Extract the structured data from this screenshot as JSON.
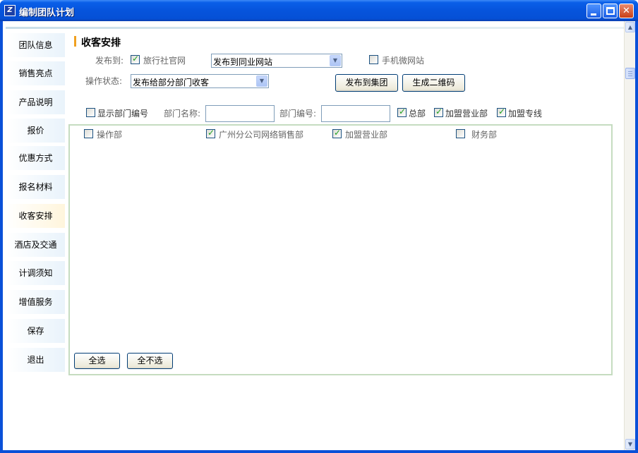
{
  "window": {
    "title": "编制团队计划",
    "app_icon": "app-logo-icon"
  },
  "sidebar": {
    "items": [
      {
        "label": "团队信息"
      },
      {
        "label": "销售亮点"
      },
      {
        "label": "产品说明"
      },
      {
        "label": "报价"
      },
      {
        "label": "优惠方式"
      },
      {
        "label": "报名材料"
      },
      {
        "label": "收客安排",
        "active": true
      },
      {
        "label": "酒店及交通"
      },
      {
        "label": "计调须知"
      },
      {
        "label": "增值服务"
      },
      {
        "label": "保存"
      },
      {
        "label": "退出"
      }
    ]
  },
  "section": {
    "title": "收客安排"
  },
  "publish": {
    "label": "发布到:",
    "official_site": {
      "label": "旅行社官网",
      "checked": true
    },
    "target_select": {
      "value": "发布到同业网站"
    },
    "mobile_site": {
      "label": "手机微网站",
      "checked": false
    }
  },
  "status": {
    "label": "操作状态:",
    "select": {
      "value": "发布给部分部门收客"
    }
  },
  "buttons": {
    "publish_group": "发布到集团",
    "qr_code": "生成二维码"
  },
  "filters": {
    "show_dept_code": {
      "label": "显示部门编号",
      "checked": false
    },
    "dept_name_label": "部门名称:",
    "dept_name_value": "",
    "dept_code_label": "部门编号:",
    "dept_code_value": "",
    "headquarters": {
      "label": "总部",
      "checked": true
    },
    "franchise_office": {
      "label": "加盟营业部",
      "checked": true
    },
    "franchise_line": {
      "label": "加盟专线",
      "checked": true
    }
  },
  "departments": [
    {
      "label": "操作部",
      "checked": false
    },
    {
      "label": "广州分公司网络销售部",
      "checked": true
    },
    {
      "label": "加盟营业部",
      "checked": true
    },
    {
      "label": "财务部",
      "checked": false
    }
  ],
  "selection": {
    "select_all": "全选",
    "select_none": "全不选"
  },
  "colors": {
    "titlebar": "#0a5fe8",
    "accent": "#f0a020",
    "panel_border": "#c5dcc0",
    "check": "#21a121"
  }
}
